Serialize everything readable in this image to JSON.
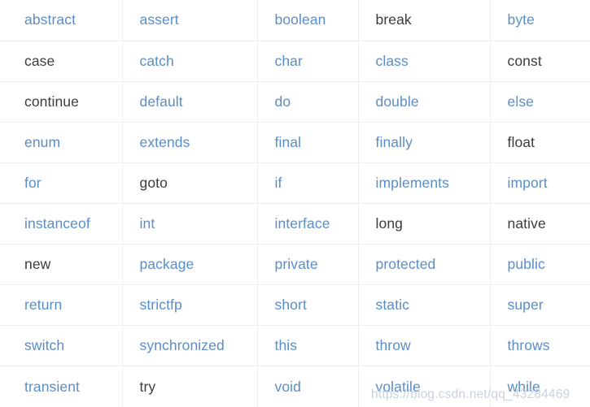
{
  "table": {
    "columns": 5,
    "rows": 10,
    "colors": {
      "link": "#5b8dc8",
      "plain": "#3c3c3c",
      "grid_line": "#eceef0",
      "background": "#ffffff"
    },
    "cells": [
      [
        {
          "label": "abstract",
          "style": "link"
        },
        {
          "label": "assert",
          "style": "link"
        },
        {
          "label": "boolean",
          "style": "link"
        },
        {
          "label": "break",
          "style": "plain"
        },
        {
          "label": "byte",
          "style": "link"
        }
      ],
      [
        {
          "label": "case",
          "style": "plain"
        },
        {
          "label": "catch",
          "style": "link"
        },
        {
          "label": "char",
          "style": "link"
        },
        {
          "label": "class",
          "style": "link"
        },
        {
          "label": "const",
          "style": "plain"
        }
      ],
      [
        {
          "label": "continue",
          "style": "plain"
        },
        {
          "label": "default",
          "style": "link"
        },
        {
          "label": "do",
          "style": "link"
        },
        {
          "label": "double",
          "style": "link"
        },
        {
          "label": "else",
          "style": "link"
        }
      ],
      [
        {
          "label": "enum",
          "style": "link"
        },
        {
          "label": "extends",
          "style": "link"
        },
        {
          "label": "final",
          "style": "link"
        },
        {
          "label": "finally",
          "style": "link"
        },
        {
          "label": "float",
          "style": "plain"
        }
      ],
      [
        {
          "label": "for",
          "style": "link"
        },
        {
          "label": "goto",
          "style": "plain"
        },
        {
          "label": "if",
          "style": "link"
        },
        {
          "label": "implements",
          "style": "link"
        },
        {
          "label": "import",
          "style": "link"
        }
      ],
      [
        {
          "label": "instanceof",
          "style": "link"
        },
        {
          "label": "int",
          "style": "link"
        },
        {
          "label": "interface",
          "style": "link"
        },
        {
          "label": "long",
          "style": "plain"
        },
        {
          "label": "native",
          "style": "plain"
        }
      ],
      [
        {
          "label": "new",
          "style": "plain"
        },
        {
          "label": "package",
          "style": "link"
        },
        {
          "label": "private",
          "style": "link"
        },
        {
          "label": "protected",
          "style": "link"
        },
        {
          "label": "public",
          "style": "link"
        }
      ],
      [
        {
          "label": "return",
          "style": "link"
        },
        {
          "label": "strictfp",
          "style": "link"
        },
        {
          "label": "short",
          "style": "link"
        },
        {
          "label": "static",
          "style": "link"
        },
        {
          "label": "super",
          "style": "link"
        }
      ],
      [
        {
          "label": "switch",
          "style": "link"
        },
        {
          "label": "synchronized",
          "style": "link"
        },
        {
          "label": "this",
          "style": "link"
        },
        {
          "label": "throw",
          "style": "link"
        },
        {
          "label": "throws",
          "style": "link"
        }
      ],
      [
        {
          "label": "transient",
          "style": "link"
        },
        {
          "label": "try",
          "style": "plain"
        },
        {
          "label": "void",
          "style": "link"
        },
        {
          "label": "volatile",
          "style": "link"
        },
        {
          "label": "while",
          "style": "link"
        }
      ]
    ]
  },
  "watermark": {
    "text": "https://blog.csdn.net/qq_43284469"
  }
}
